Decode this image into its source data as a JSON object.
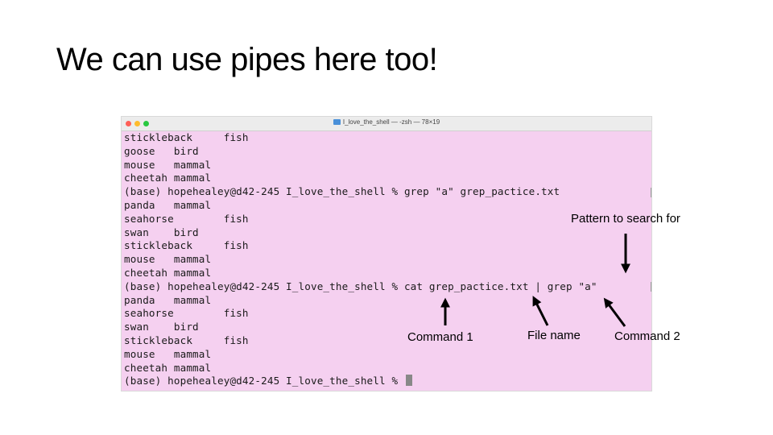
{
  "slide": {
    "title": "We can use pipes here too!"
  },
  "terminal": {
    "window_title": "I_love_the_shell — -zsh — 78×19",
    "lines": [
      "stickleback     fish",
      "goose   bird",
      "mouse   mammal",
      "cheetah mammal",
      "(base) hopehealey@d42-245 I_love_the_shell % grep \"a\" grep_pactice.txt",
      "panda   mammal",
      "seahorse        fish",
      "swan    bird",
      "stickleback     fish",
      "mouse   mammal",
      "cheetah mammal",
      "(base) hopehealey@d42-245 I_love_the_shell % cat grep_pactice.txt | grep \"a\"",
      "panda   mammal",
      "seahorse        fish",
      "swan    bird",
      "stickleback     fish",
      "mouse   mammal",
      "cheetah mammal",
      "(base) hopehealey@d42-245 I_love_the_shell % "
    ]
  },
  "annotations": {
    "pattern": "Pattern to search for",
    "command1": "Command 1",
    "file_name": "File name",
    "command2": "Command 2"
  },
  "colors": {
    "terminal_background": "#f5d0f0",
    "text": "#1a1a1a"
  }
}
